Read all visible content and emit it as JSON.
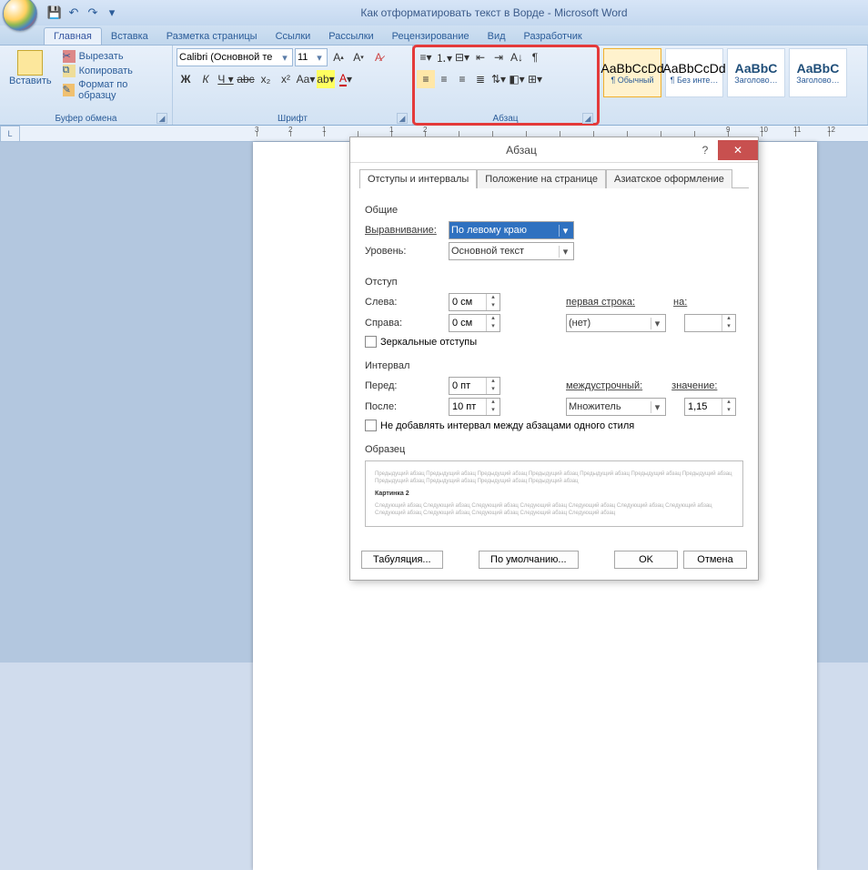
{
  "title": "Как отформатировать текст в Ворде - Microsoft Word",
  "tabs": [
    "Главная",
    "Вставка",
    "Разметка страницы",
    "Ссылки",
    "Рассылки",
    "Рецензирование",
    "Вид",
    "Разработчик"
  ],
  "clipboard": {
    "paste": "Вставить",
    "cut": "Вырезать",
    "copy": "Копировать",
    "format": "Формат по образцу",
    "label": "Буфер обмена"
  },
  "font": {
    "name": "Calibri (Основной те",
    "size": "11",
    "label": "Шрифт"
  },
  "para": {
    "label": "Абзац"
  },
  "styles": {
    "s1": {
      "preview": "AaBbCcDd",
      "name": "¶ Обычный"
    },
    "s2": {
      "preview": "AaBbCcDd",
      "name": "¶ Без инте…"
    },
    "s3": {
      "preview": "АаBbC",
      "name": "Заголово…"
    },
    "s4": {
      "preview": "AaBbC",
      "name": "Заголово…"
    }
  },
  "ruler": [
    "3",
    "2",
    "1",
    "",
    "1",
    "2",
    "",
    "",
    "",
    "",
    "",
    "",
    "",
    "",
    "",
    "",
    "9",
    "10",
    "11",
    "12"
  ],
  "dialog": {
    "title": "Абзац",
    "tabs": [
      "Отступы и интервалы",
      "Положение на странице",
      "Азиатское оформление"
    ],
    "sec_general": "Общие",
    "align_lbl": "Выравнивание:",
    "align_val": "По левому краю",
    "level_lbl": "Уровень:",
    "level_val": "Основной текст",
    "sec_indent": "Отступ",
    "left_lbl": "Слева:",
    "left_val": "0 см",
    "right_lbl": "Справа:",
    "right_val": "0 см",
    "first_lbl": "первая строка:",
    "first_val": "(нет)",
    "by_lbl": "на:",
    "mirror": "Зеркальные отступы",
    "sec_spacing": "Интервал",
    "before_lbl": "Перед:",
    "before_val": "0 пт",
    "after_lbl": "После:",
    "after_val": "10 пт",
    "line_lbl": "междустрочный:",
    "line_val": "Множитель",
    "at_lbl": "значение:",
    "at_val": "1,15",
    "noadd": "Не добавлять интервал между абзацами одного стиля",
    "sec_preview": "Образец",
    "prev_before": "Предыдущий абзац Предыдущий абзац Предыдущий абзац Предыдущий абзац Предыдущий абзац Предыдущий абзац Предыдущий абзац Предыдущий абзац Предыдущий абзац Предыдущий абзац Предыдущий абзац",
    "prev_sample": "Картинка 2",
    "prev_after": "Следующий абзац Следующий абзац Следующий абзац Следующий абзац Следующий абзац Следующий абзац Следующий абзац Следующий абзац Следующий абзац Следующий абзац Следующий абзац Следующий абзац",
    "tabs_btn": "Табуляция...",
    "default_btn": "По умолчанию...",
    "ok": "OK",
    "cancel": "Отмена"
  }
}
